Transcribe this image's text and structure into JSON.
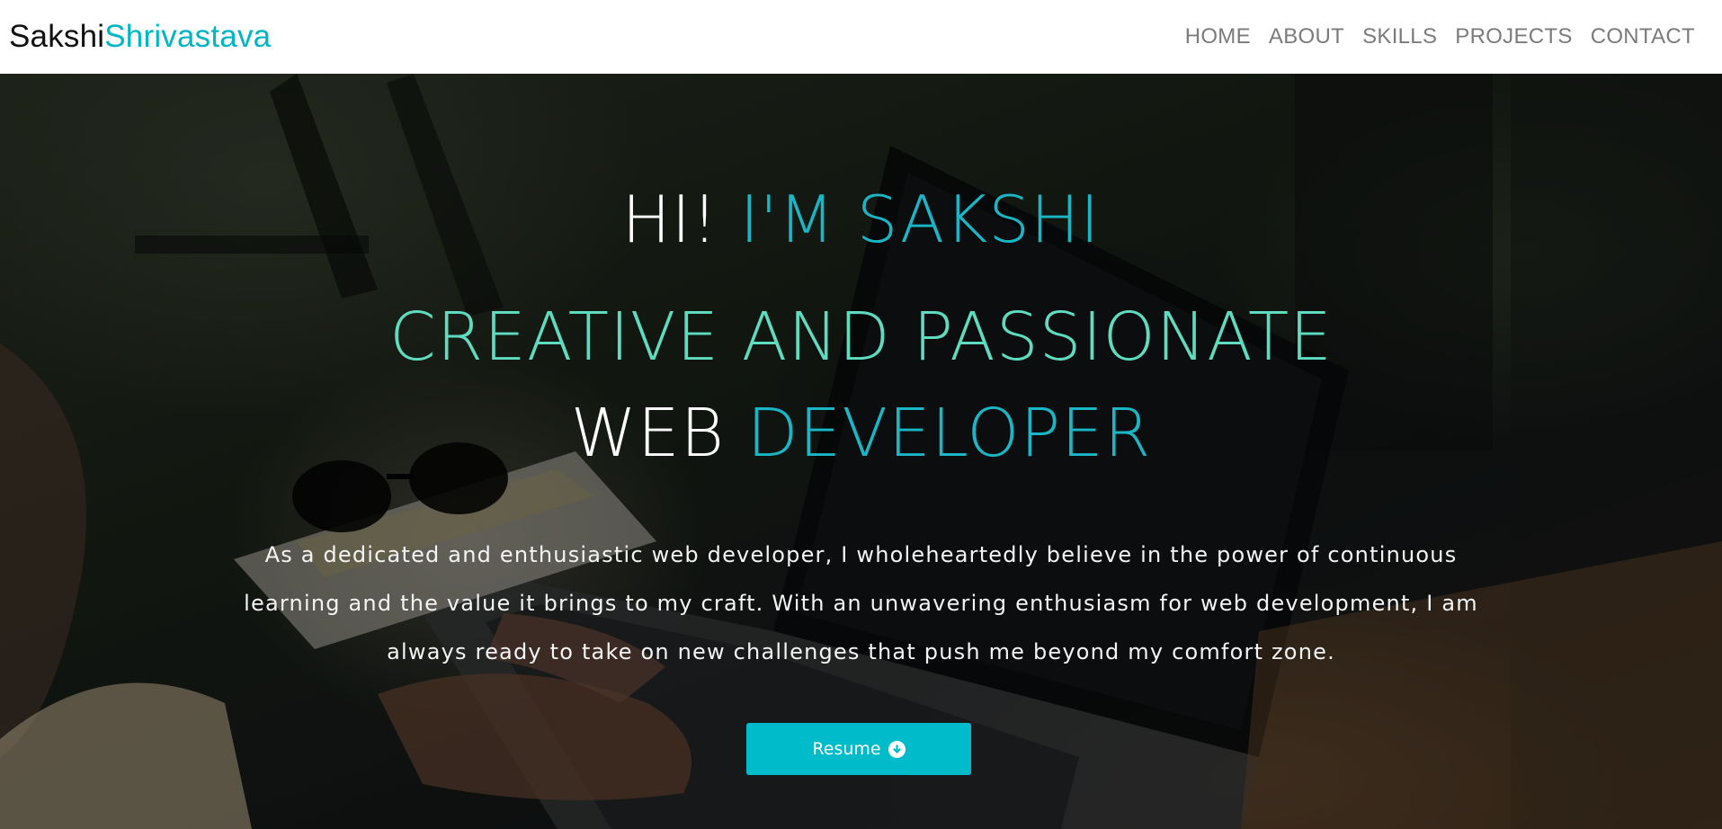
{
  "navbar": {
    "brand_first": "Sakshi",
    "brand_last": "Shrivastava",
    "links": [
      "HOME",
      "ABOUT",
      "SKILLS",
      "PROJECTS",
      "CONTACT"
    ]
  },
  "hero": {
    "greeting_prefix": "HI!",
    "greeting_name": "I'M SAKSHI",
    "tagline": "CREATIVE AND PASSIONATE",
    "role_prefix": "WEB",
    "role_highlight": "DEVELOPER",
    "description": "As a dedicated and enthusiastic web developer, I wholeheartedly believe in the power of continuous learning and the value it brings to my craft. With an unwavering enthusiasm for web development, I am always ready to take on new challenges that push me beyond my comfort zone.",
    "resume_label": "Resume",
    "resume_icon": "download-circle-icon"
  },
  "colors": {
    "accent_cyan": "#00b5c4",
    "accent_mint": "#5fdcc0",
    "button": "#00bccb"
  }
}
